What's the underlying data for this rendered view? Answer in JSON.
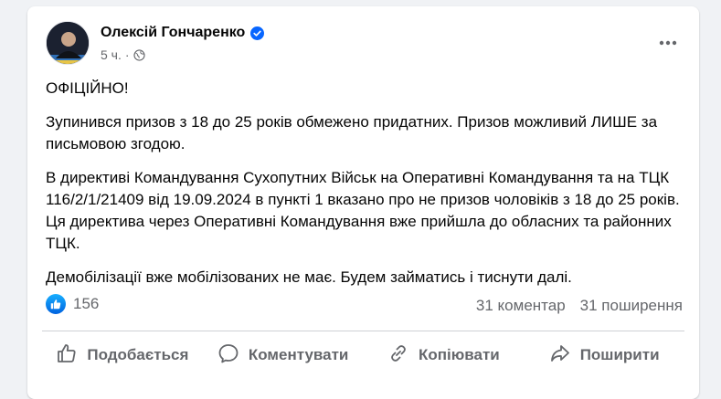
{
  "post": {
    "author": "Олексій Гончаренко",
    "time": "5 ч.",
    "paragraphs": [
      "ОФІЦІЙНО!",
      "Зупинився призов з 18 до 25 років обмежено придатних. Призов можливий ЛИШЕ за письмовою згодою.",
      "В директиві Командування Сухопутних Військ на Оперативні Командування та на ТЦК 116/2/1/21409 від 19.09.2024 в пункті 1 вказано про не призов чоловіків з 18 до 25 років. Ця директива через Оперативні Командування вже прийшла до обласних та районних ТЦК.",
      "Демобілізації вже мобілізованих не має. Будем займатись і тиснути далі."
    ],
    "reactions_count": "156",
    "comments": "31 коментар",
    "shares": "31 поширення"
  },
  "actions": {
    "like": "Подобається",
    "comment": "Коментувати",
    "copy": "Копіювати",
    "share": "Поширити"
  },
  "colors": {
    "accent": "#0866ff",
    "secondary_text": "#65676b",
    "background": "#f0f2f5"
  },
  "icons": [
    "verified-badge-icon",
    "globe-icon",
    "more-options-icon",
    "like-reaction-icon",
    "thumbs-up-icon",
    "comment-icon",
    "copy-icon",
    "share-icon"
  ]
}
